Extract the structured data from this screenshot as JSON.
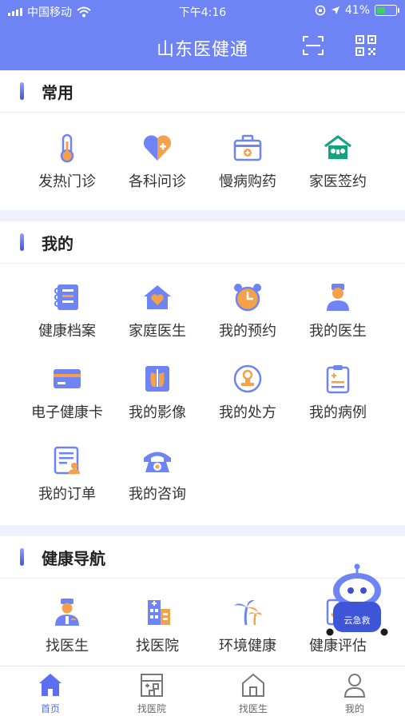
{
  "status_bar": {
    "carrier": "中国移动",
    "time": "下午4:16",
    "battery": "41%"
  },
  "header": {
    "title": "山东医健通",
    "scan_icon": "scan-icon",
    "qr_icon": "qr-code-icon"
  },
  "sections": {
    "common": {
      "title": "常用",
      "items": [
        {
          "label": "发热门诊",
          "icon": "thermometer-icon"
        },
        {
          "label": "各科问诊",
          "icon": "heart-plus-icon"
        },
        {
          "label": "慢病购药",
          "icon": "medicine-box-icon"
        },
        {
          "label": "家医签约",
          "icon": "family-doctor-icon"
        }
      ]
    },
    "mine": {
      "title": "我的",
      "items": [
        {
          "label": "健康档案",
          "icon": "health-record-icon"
        },
        {
          "label": "家庭医生",
          "icon": "home-heart-icon"
        },
        {
          "label": "我的预约",
          "icon": "alarm-clock-icon"
        },
        {
          "label": "我的医生",
          "icon": "doctor-icon"
        },
        {
          "label": "电子健康卡",
          "icon": "card-icon"
        },
        {
          "label": "我的影像",
          "icon": "xray-icon"
        },
        {
          "label": "我的处方",
          "icon": "prescription-stamp-icon"
        },
        {
          "label": "我的病例",
          "icon": "medical-record-clipboard-icon"
        },
        {
          "label": "我的订单",
          "icon": "order-list-icon"
        },
        {
          "label": "我的咨询",
          "icon": "telephone-icon"
        }
      ]
    },
    "navigation": {
      "title": "健康导航",
      "items": [
        {
          "label": "找医生",
          "icon": "find-doctor-icon"
        },
        {
          "label": "找医院",
          "icon": "hospital-building-icon"
        },
        {
          "label": "环境健康",
          "icon": "palm-tree-icon"
        },
        {
          "label": "健康评估",
          "icon": "assessment-icon"
        }
      ]
    }
  },
  "floating": {
    "label": "云急救",
    "icon": "robot-icon"
  },
  "bottom_nav": [
    {
      "label": "首页",
      "icon": "home-icon",
      "active": true
    },
    {
      "label": "找医院",
      "icon": "hospital-icon",
      "active": false
    },
    {
      "label": "找医生",
      "icon": "doctor-house-icon",
      "active": false
    },
    {
      "label": "我的",
      "icon": "user-icon",
      "active": false
    }
  ],
  "colors": {
    "brand": "#6e84f5",
    "accent": "#5b6ff0",
    "orange": "#f5a04a",
    "green": "#14a37f"
  }
}
